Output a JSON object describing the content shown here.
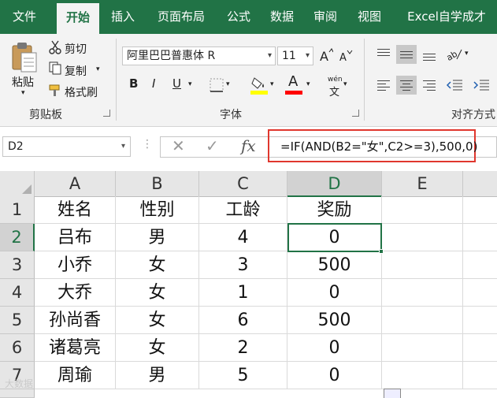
{
  "ribbon_tabs": [
    "文件",
    "开始",
    "插入",
    "页面布局",
    "公式",
    "数据",
    "审阅",
    "视图",
    "Excel自学成才"
  ],
  "active_tab": "开始",
  "clipboard": {
    "paste_label": "粘贴",
    "cut_label": "剪切",
    "copy_label": "复制",
    "format_painter_label": "格式刷",
    "group_label": "剪贴板"
  },
  "font": {
    "font_name": "阿里巴巴普惠体 R",
    "font_size": "11",
    "bold": "B",
    "italic": "I",
    "underline": "U",
    "font_color_glyph": "A",
    "phonetic_glyph": "wén",
    "phonetic_sub": "文",
    "group_label": "字体"
  },
  "alignment": {
    "group_label": "对齐方式"
  },
  "formula_bar": {
    "name_box": "D2",
    "cancel_glyph": "✕",
    "enter_glyph": "✓",
    "fx_glyph": "fx",
    "formula": "=IF(AND(B2=\"女\",C2>=3),500,0)"
  },
  "sheet": {
    "columns": [
      "A",
      "B",
      "C",
      "D",
      "E"
    ],
    "rows": [
      "1",
      "2",
      "3",
      "4",
      "5",
      "6",
      "7"
    ],
    "cells": [
      [
        "姓名",
        "性别",
        "工龄",
        "奖励",
        ""
      ],
      [
        "吕布",
        "男",
        "4",
        "0",
        ""
      ],
      [
        "小乔",
        "女",
        "3",
        "500",
        ""
      ],
      [
        "大乔",
        "女",
        "1",
        "0",
        ""
      ],
      [
        "孙尚香",
        "女",
        "6",
        "500",
        ""
      ],
      [
        "诸葛亮",
        "女",
        "2",
        "0",
        ""
      ],
      [
        "周瑜",
        "男",
        "5",
        "0",
        ""
      ]
    ],
    "active_cell": "D2"
  },
  "watermark": "大数据",
  "colors": {
    "excel_green": "#217346",
    "highlight_red": "#e0372e",
    "fill_yellow": "#ffff00",
    "font_red": "#ff0000"
  }
}
